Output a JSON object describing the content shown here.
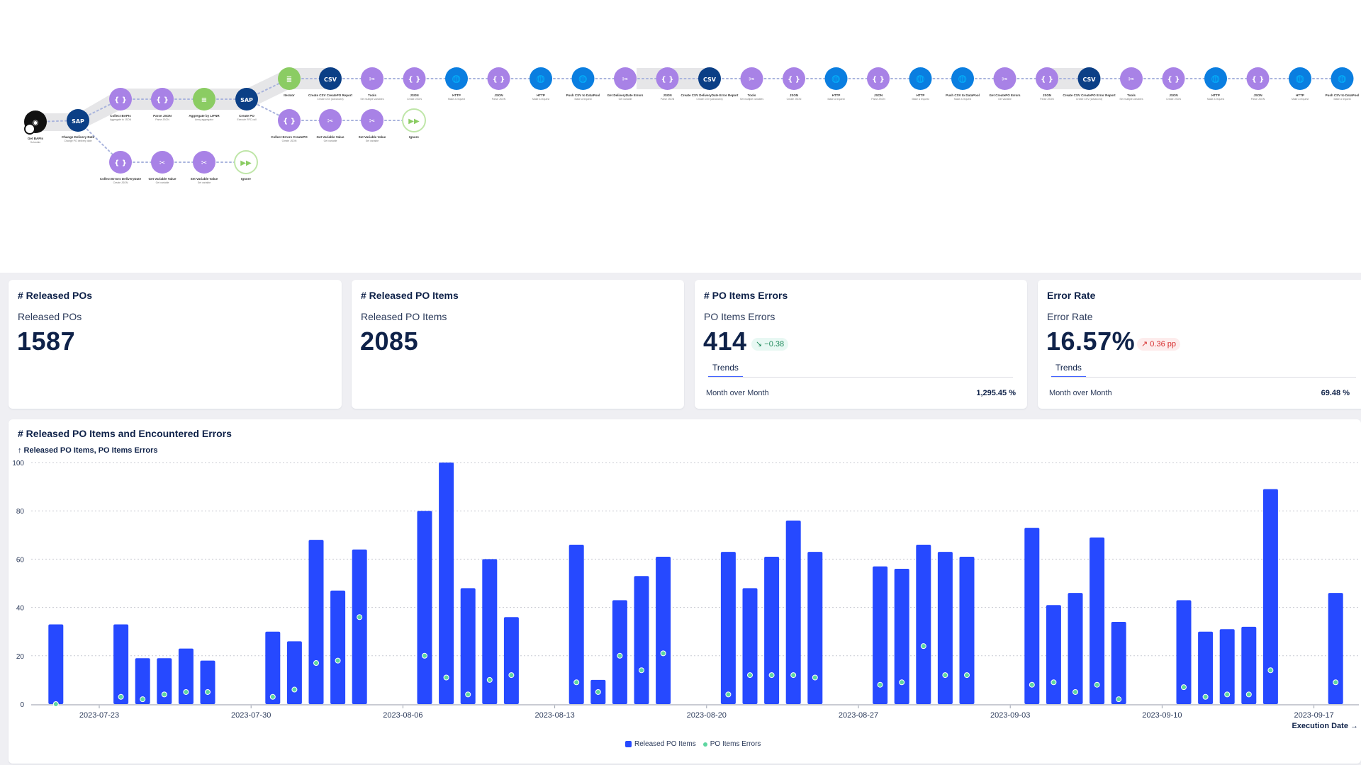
{
  "workflow": {
    "nodes": [
      {
        "id": "n1",
        "label": "Get BAPIs",
        "sub": "Schedule",
        "kind": "trigger"
      },
      {
        "id": "n2",
        "label": "Change Delivery Date",
        "sub": "Change PO delivery date",
        "kind": "sap"
      },
      {
        "id": "n3",
        "label": "Collect BAPIs",
        "sub": "Aggregate to JSON",
        "kind": "json"
      },
      {
        "id": "n4",
        "label": "Parse JSON",
        "sub": "Parse JSON",
        "kind": "json"
      },
      {
        "id": "n5",
        "label": "Aggregate by LIFNR",
        "sub": "Array aggregator",
        "kind": "aggregator"
      },
      {
        "id": "n6",
        "label": "Create PO",
        "sub": "Execute RFC call",
        "kind": "sap"
      },
      {
        "id": "n7",
        "label": "Iterator",
        "sub": "",
        "kind": "iterator"
      },
      {
        "id": "n8",
        "label": "Create CSV CreatePO Report",
        "sub": "Create CSV (advanced)",
        "kind": "csv"
      },
      {
        "id": "n9",
        "label": "Tools",
        "sub": "Set multiple variables",
        "kind": "tools"
      },
      {
        "id": "n10",
        "label": "JSON",
        "sub": "Create JSON",
        "kind": "json"
      },
      {
        "id": "n11",
        "label": "HTTP",
        "sub": "Make a request",
        "kind": "http"
      },
      {
        "id": "n12",
        "label": "JSON",
        "sub": "Parse JSON",
        "kind": "json"
      },
      {
        "id": "n13",
        "label": "HTTP",
        "sub": "Make a request",
        "kind": "http"
      },
      {
        "id": "n14",
        "label": "Push CSV to DataPool",
        "sub": "Make a request",
        "kind": "http"
      },
      {
        "id": "n15",
        "label": "Get DeliveryDate Errors",
        "sub": "Get variable",
        "kind": "tools"
      },
      {
        "id": "n16",
        "label": "JSON",
        "sub": "Parse JSON",
        "kind": "json"
      },
      {
        "id": "n17",
        "label": "Create CSV DeliveryDate Error Report",
        "sub": "Create CSV (advanced)",
        "kind": "csv"
      },
      {
        "id": "n18",
        "label": "Tools",
        "sub": "Set multiple variables",
        "kind": "tools"
      },
      {
        "id": "n19",
        "label": "JSON",
        "sub": "Create JSON",
        "kind": "json"
      },
      {
        "id": "n20",
        "label": "HTTP",
        "sub": "Make a request",
        "kind": "http"
      },
      {
        "id": "n21",
        "label": "JSON",
        "sub": "Parse JSON",
        "kind": "json"
      },
      {
        "id": "n22",
        "label": "HTTP",
        "sub": "Make a request",
        "kind": "http"
      },
      {
        "id": "n23",
        "label": "Push CSV to DataPool",
        "sub": "Make a request",
        "kind": "http"
      },
      {
        "id": "n24",
        "label": "Get CreatePO Errors",
        "sub": "Get variable",
        "kind": "tools"
      },
      {
        "id": "n25",
        "label": "JSON",
        "sub": "Parse JSON",
        "kind": "json"
      },
      {
        "id": "n26",
        "label": "Create CSV CreatePO Error Report",
        "sub": "Create CSV (advanced)",
        "kind": "csv"
      },
      {
        "id": "n27",
        "label": "Tools",
        "sub": "Set multiple variables",
        "kind": "tools"
      },
      {
        "id": "n28",
        "label": "JSON",
        "sub": "Create JSON",
        "kind": "json"
      },
      {
        "id": "n29",
        "label": "HTTP",
        "sub": "Make a request",
        "kind": "http"
      },
      {
        "id": "n30",
        "label": "JSON",
        "sub": "Parse JSON",
        "kind": "json"
      },
      {
        "id": "n31",
        "label": "HTTP",
        "sub": "Make a request",
        "kind": "http"
      },
      {
        "id": "n32",
        "label": "Push CSV to DataPool",
        "sub": "Make a request",
        "kind": "http"
      },
      {
        "id": "b1",
        "label": "Collect Errors CreatePO",
        "sub": "Create JSON",
        "kind": "json"
      },
      {
        "id": "b2",
        "label": "Get Variable Value",
        "sub": "Get variable",
        "kind": "tools"
      },
      {
        "id": "b3",
        "label": "Set Variable Value",
        "sub": "Set variable",
        "kind": "tools"
      },
      {
        "id": "b4",
        "label": "Ignore",
        "sub": "",
        "kind": "ignore"
      },
      {
        "id": "c1",
        "label": "Collect Errors DeliveryDate",
        "sub": "Create JSON",
        "kind": "json"
      },
      {
        "id": "c2",
        "label": "Get Variable Value",
        "sub": "Get variable",
        "kind": "tools"
      },
      {
        "id": "c3",
        "label": "Set Variable Value",
        "sub": "Set variable",
        "kind": "tools"
      },
      {
        "id": "c4",
        "label": "Ignore",
        "sub": "",
        "kind": "ignore"
      }
    ],
    "colors": {
      "json": "#a882e6",
      "tools": "#a882e6",
      "http": "#0a7ee0",
      "csv": "#0b3f86",
      "sap": "#0b3f86",
      "aggregator": "#8bcc63",
      "iterator": "#8bcc63",
      "ignore": "#ffffff",
      "trigger": "#111111"
    }
  },
  "kpis": [
    {
      "title": "# Released POs",
      "subtitle": "Released POs",
      "value": "1587"
    },
    {
      "title": "# Released PO Items",
      "subtitle": "Released PO Items",
      "value": "2085"
    },
    {
      "title": "# PO Items Errors",
      "subtitle": "PO Items Errors",
      "value": "414",
      "delta": "↘ −0.38",
      "delta_dir": "down",
      "tab": "Trends",
      "mom_label": "Month over Month",
      "mom_value": "1,295.45 %"
    },
    {
      "title": "Error Rate",
      "subtitle": "Error Rate",
      "value": "16.57%",
      "delta": "↗ 0.36 pp",
      "delta_dir": "up",
      "tab": "Trends",
      "mom_label": "Month over Month",
      "mom_value": "69.48 %"
    }
  ],
  "chart_data": {
    "type": "bar",
    "title": "# Released PO Items and Encountered Errors",
    "ylabel": "↑ Released PO Items, PO Items Errors",
    "xlabel": "Execution Date →",
    "ylim": [
      0,
      100
    ],
    "yticks": [
      0,
      20,
      40,
      60,
      80,
      100
    ],
    "xticks": [
      "2023-07-23",
      "2023-07-30",
      "2023-08-06",
      "2023-08-13",
      "2023-08-20",
      "2023-08-27",
      "2023-09-03",
      "2023-09-10",
      "2023-09-17"
    ],
    "grid": true,
    "legend_position": "bottom-center",
    "x": [
      "2023-07-21",
      "2023-07-24",
      "2023-07-25",
      "2023-07-26",
      "2023-07-27",
      "2023-07-28",
      "2023-07-31",
      "2023-08-01",
      "2023-08-02",
      "2023-08-03",
      "2023-08-04",
      "2023-08-07",
      "2023-08-08",
      "2023-08-09",
      "2023-08-10",
      "2023-08-11",
      "2023-08-14",
      "2023-08-15",
      "2023-08-16",
      "2023-08-17",
      "2023-08-18",
      "2023-08-21",
      "2023-08-22",
      "2023-08-23",
      "2023-08-24",
      "2023-08-25",
      "2023-08-28",
      "2023-08-29",
      "2023-08-30",
      "2023-08-31",
      "2023-09-01",
      "2023-09-04",
      "2023-09-05",
      "2023-09-06",
      "2023-09-07",
      "2023-09-08",
      "2023-09-11",
      "2023-09-12",
      "2023-09-13",
      "2023-09-14",
      "2023-09-15",
      "2023-09-18"
    ],
    "series": [
      {
        "name": "Released PO Items",
        "type": "bar",
        "color": "#2649ff",
        "values": [
          33,
          33,
          19,
          19,
          23,
          18,
          30,
          26,
          68,
          47,
          64,
          80,
          100,
          48,
          60,
          36,
          66,
          10,
          43,
          53,
          61,
          63,
          48,
          61,
          76,
          63,
          57,
          56,
          66,
          63,
          61,
          73,
          41,
          46,
          69,
          34,
          43,
          30,
          31,
          32,
          89,
          46
        ]
      },
      {
        "name": "PO Items Errors",
        "type": "scatter",
        "color": "#5ed6a0",
        "values": [
          0,
          3,
          2,
          4,
          5,
          5,
          3,
          6,
          17,
          18,
          36,
          20,
          11,
          4,
          10,
          12,
          9,
          5,
          20,
          14,
          21,
          4,
          12,
          12,
          12,
          11,
          8,
          9,
          24,
          12,
          12,
          8,
          9,
          5,
          8,
          2,
          7,
          3,
          4,
          4,
          14,
          9
        ]
      }
    ]
  }
}
